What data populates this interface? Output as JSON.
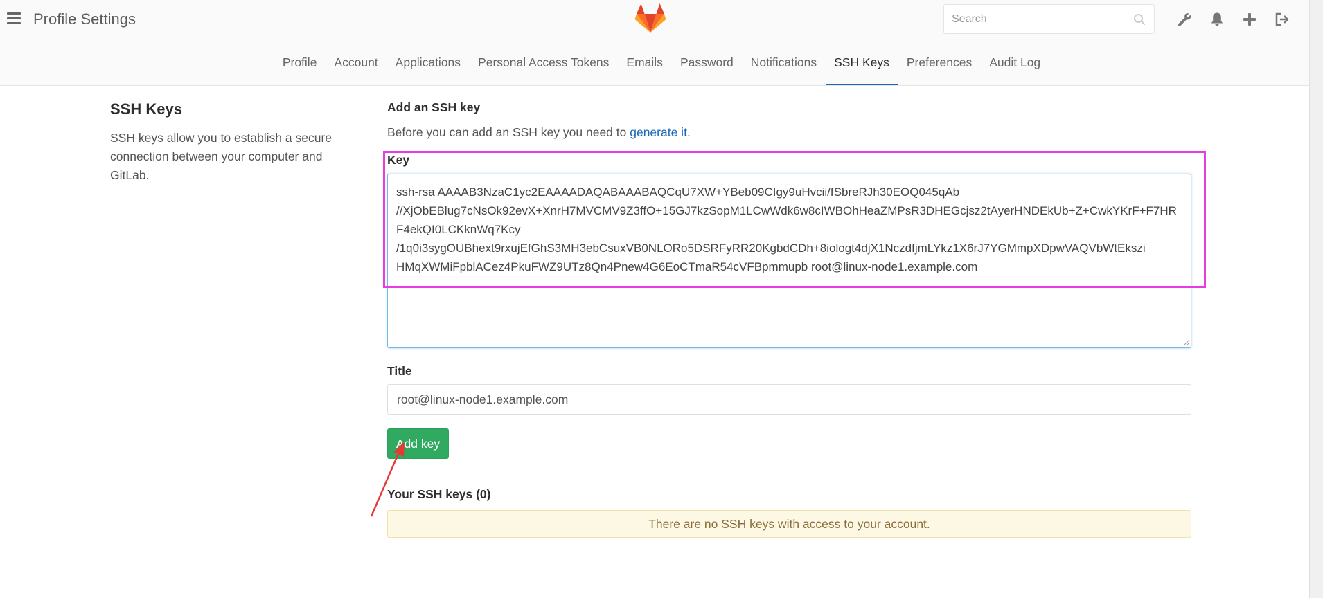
{
  "header": {
    "app_title": "Profile Settings",
    "search_placeholder": "Search",
    "icons": [
      "wrench-icon",
      "bell-icon",
      "plus-icon",
      "sign-out-icon"
    ]
  },
  "tabs": [
    {
      "label": "Profile",
      "active": false
    },
    {
      "label": "Account",
      "active": false
    },
    {
      "label": "Applications",
      "active": false
    },
    {
      "label": "Personal Access Tokens",
      "active": false
    },
    {
      "label": "Emails",
      "active": false
    },
    {
      "label": "Password",
      "active": false
    },
    {
      "label": "Notifications",
      "active": false
    },
    {
      "label": "SSH Keys",
      "active": true
    },
    {
      "label": "Preferences",
      "active": false
    },
    {
      "label": "Audit Log",
      "active": false
    }
  ],
  "sidebar": {
    "title": "SSH Keys",
    "description": "SSH keys allow you to establish a secure connection between your computer and GitLab."
  },
  "form": {
    "heading": "Add an SSH key",
    "intro_text": "Before you can add an SSH key you need to ",
    "intro_link": "generate it",
    "intro_end": ".",
    "key_label": "Key",
    "key_value": "ssh-rsa AAAAB3NzaC1yc2EAAAADAQABAAABAQCqU7XW+YBeb09CIgy9uHvcii/fSbreRJh30EOQ045qAb\n//XjObEBlug7cNsOk92evX+XnrH7MVCMV9Z3ffO+15GJ7kzSopM1LCwWdk6w8cIWBOhHeaZMPsR3DHEGcjsz2tAyerHNDEkUb+Z+CwkYKrF+F7HRF4ekQI0LCKknWq7Kcy\n/1q0i3sygOUBhext9rxujEfGhS3MH3ebCsuxVB0NLORo5DSRFyRR20KgbdCDh+8iologt4djX1NczdfjmLYkz1X6rJ7YGMmpXDpwVAQVbWtEkszi HMqXWMiFpblACez4PkuFWZ9UTz8Qn4Pnew4G6EoCTmaR54cVFBpmmupb root@linux-node1.example.com",
    "title_label": "Title",
    "title_value": "root@linux-node1.example.com",
    "submit_label": "Add key"
  },
  "keys_section": {
    "heading": "Your SSH keys (0)",
    "empty_message": "There are no SSH keys with access to your account."
  },
  "colors": {
    "accent": "#1b69b6",
    "button_green": "#2faa60",
    "highlight_magenta": "#e63ce0",
    "arrow_red": "#e53935",
    "alert_bg": "#fcf8e3"
  }
}
